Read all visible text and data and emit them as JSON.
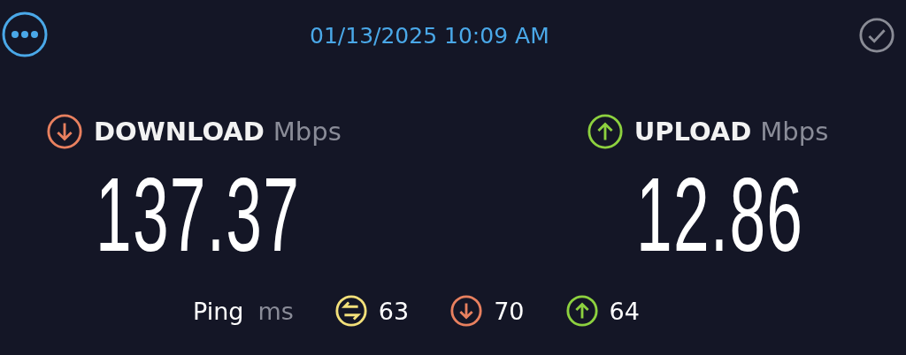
{
  "header": {
    "timestamp": "01/13/2025 10:09 AM"
  },
  "metrics": [
    {
      "kind": "download",
      "label": "DOWNLOAD",
      "unit": "Mbps",
      "value": "137.37",
      "color": "#e8805f"
    },
    {
      "kind": "upload",
      "label": "UPLOAD",
      "unit": "Mbps",
      "value": "12.86",
      "color": "#8dd13f"
    }
  ],
  "ping": {
    "label": "Ping",
    "unit": "ms",
    "stats": [
      {
        "kind": "idle",
        "value": "63",
        "color": "#f3e07a"
      },
      {
        "kind": "download",
        "value": "70",
        "color": "#e8805f"
      },
      {
        "kind": "upload",
        "value": "64",
        "color": "#8dd13f"
      }
    ]
  }
}
